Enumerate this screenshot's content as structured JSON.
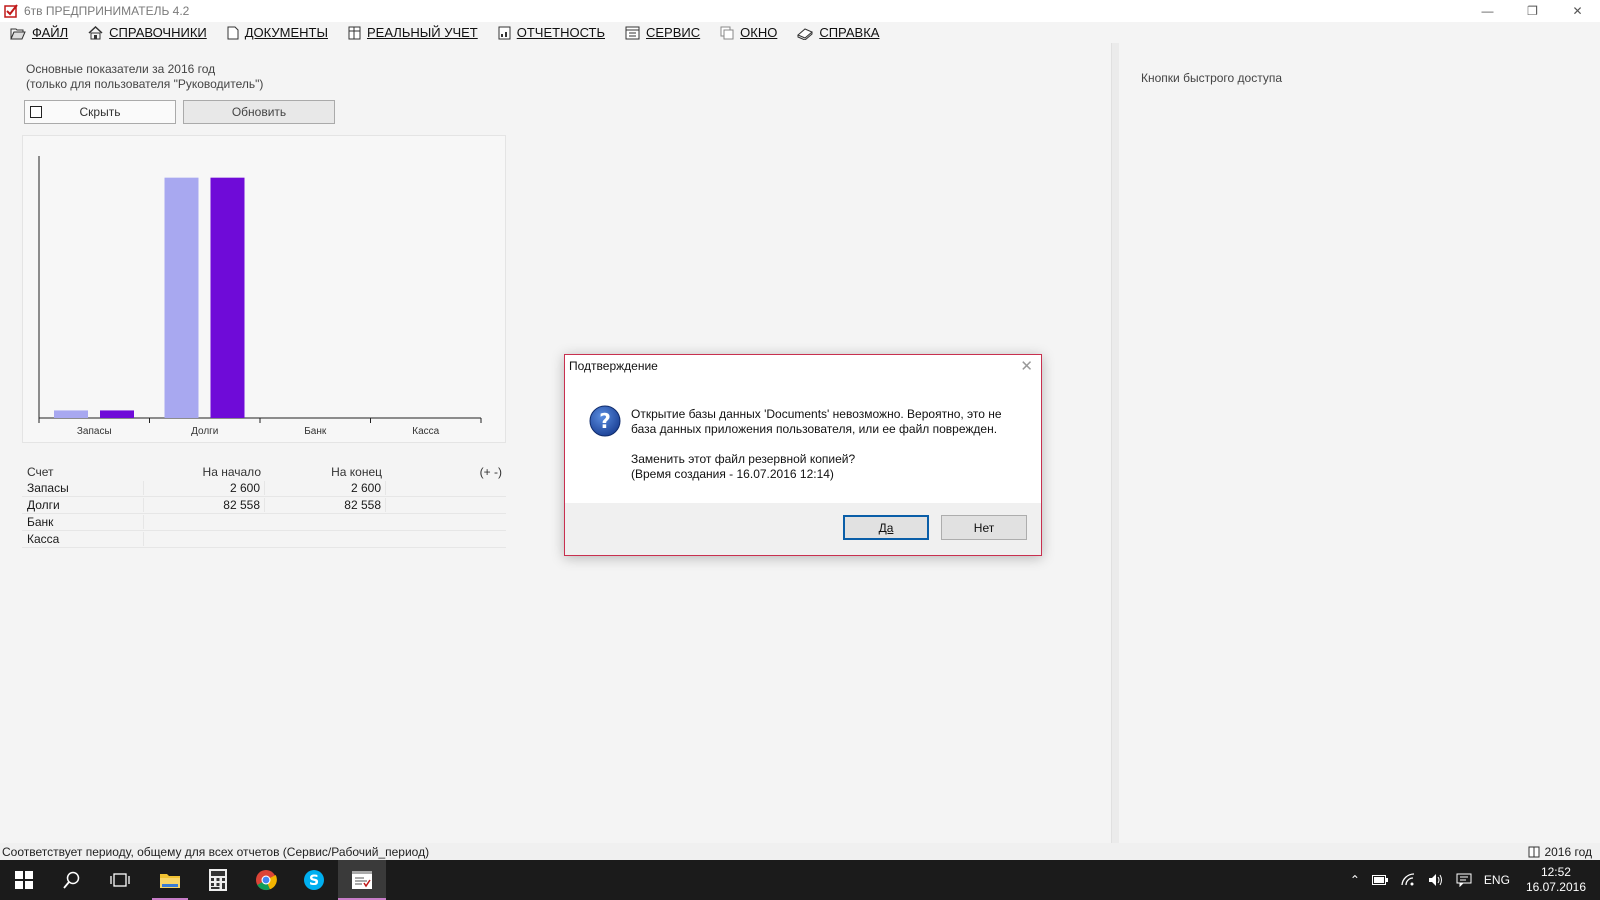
{
  "window": {
    "title": "6тв  ПРЕДПРИНИМАТЕЛЬ 4.2"
  },
  "menu": [
    {
      "label": "ФАЙЛ",
      "icon": "folder-open-icon"
    },
    {
      "label": "СПРАВОЧНИКИ",
      "icon": "home-icon"
    },
    {
      "label": "ДОКУМЕНТЫ",
      "icon": "document-icon"
    },
    {
      "label": "РЕАЛЬНЫЙ УЧЕТ",
      "icon": "ledger-icon"
    },
    {
      "label": "ОТЧЕТНОСТЬ",
      "icon": "report-icon"
    },
    {
      "label": "СЕРВИС",
      "icon": "service-icon"
    },
    {
      "label": "ОКНО",
      "icon": "window-icon"
    },
    {
      "label": "СПРАВКА",
      "icon": "help-book-icon"
    }
  ],
  "kpi": {
    "title": "Основные показатели за 2016 год",
    "subtitle": "(только для пользователя \"Руководитель\")",
    "hide_label": "Скрыть",
    "refresh_label": "Обновить"
  },
  "chart_data": {
    "type": "bar",
    "categories": [
      "Запасы",
      "Долги",
      "Банк",
      "Касса"
    ],
    "series": [
      {
        "name": "На начало",
        "values": [
          2600,
          82558,
          0,
          0
        ],
        "color": "#a8a8f0"
      },
      {
        "name": "На конец",
        "values": [
          2600,
          82558,
          0,
          0
        ],
        "color": "#6f0bd8"
      }
    ],
    "ylim": [
      0,
      90000
    ],
    "grid": false
  },
  "table": {
    "headers": [
      "Счет",
      "На начало",
      "На конец",
      "(+ -)"
    ],
    "rows": [
      [
        "Запасы",
        "2 600",
        "2 600",
        ""
      ],
      [
        "Долги",
        "82 558",
        "82 558",
        ""
      ],
      [
        "Банк",
        "",
        "",
        ""
      ],
      [
        "Касса",
        "",
        "",
        ""
      ]
    ]
  },
  "right_panel": {
    "title": "Кнопки быстрого доступа"
  },
  "status": {
    "text": "Соответствует периоду, общему для всех отчетов (Сервис/Рабочий_период)",
    "period": "2016 год"
  },
  "dialog": {
    "title": "Подтверждение",
    "message": "Открытие базы данных 'Documents' невозможно.  Вероятно, это не база данных приложения пользователя, или ее файл поврежден.",
    "question": "Заменить этот файл резервной копией?",
    "created": "(Время создания - 16.07.2016  12:14)",
    "yes_label": "Да",
    "no_label": "Нет"
  },
  "taskbar": {
    "lang": "ENG",
    "time": "12:52",
    "date": "16.07.2016"
  }
}
